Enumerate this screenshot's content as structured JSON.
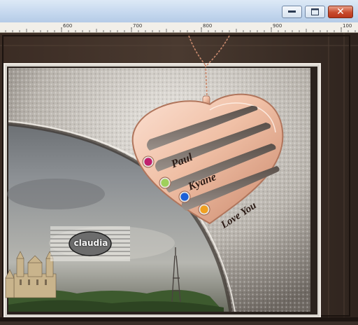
{
  "window": {
    "buttons": {
      "minimize_icon": "minimize-icon",
      "maximize_icon": "maximize-icon",
      "close_glyph": "✕"
    }
  },
  "ruler": {
    "labels": [
      "600",
      "700",
      "800",
      "900",
      "100"
    ]
  },
  "canvas": {
    "watermark_text": "claudia",
    "pendant_names": [
      "Paul",
      "Kyane",
      "Love You"
    ],
    "birthstone_colors": [
      "#c0206e",
      "#9ed05c",
      "#1c60d8",
      "#f0a020"
    ]
  }
}
